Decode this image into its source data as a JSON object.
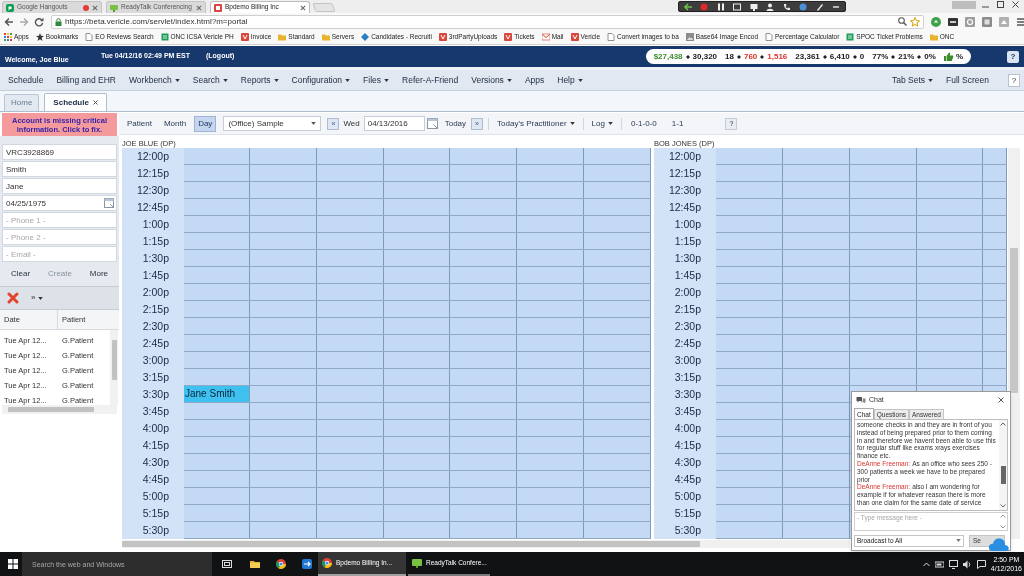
{
  "browser": {
    "tabs": [
      {
        "title": "Google Hangouts",
        "selected": false,
        "recording": true
      },
      {
        "title": "ReadyTalk Conferencing",
        "selected": false,
        "recording": false
      },
      {
        "title": "Bpdemo Billing Inc",
        "selected": true,
        "recording": false
      }
    ],
    "url": "https://beta.vericle.com/servlet/index.html?m=portal",
    "bookmarks": [
      {
        "label": "Apps",
        "kind": "apps"
      },
      {
        "label": "Bookmarks",
        "kind": "star"
      },
      {
        "label": "EO Reviews Search",
        "kind": "page"
      },
      {
        "label": "ONC ICSA Vericle PH",
        "kind": "sheet"
      },
      {
        "label": "Invoice",
        "kind": "logo"
      },
      {
        "label": "Standard",
        "kind": "folder"
      },
      {
        "label": "Servers",
        "kind": "folder"
      },
      {
        "label": "Candidates - Recruiti",
        "kind": "diamond"
      },
      {
        "label": "3rdPartyUploads",
        "kind": "logo"
      },
      {
        "label": "Tickets",
        "kind": "logo"
      },
      {
        "label": "Mail",
        "kind": "mail"
      },
      {
        "label": "Vericle",
        "kind": "logo"
      },
      {
        "label": "Convert images to ba",
        "kind": "page"
      },
      {
        "label": "Base64 Image Encod",
        "kind": "image"
      },
      {
        "label": "Percentage Calculator",
        "kind": "page"
      },
      {
        "label": "SPOC Ticket Problems",
        "kind": "sheet"
      },
      {
        "label": "ONC",
        "kind": "folder"
      }
    ]
  },
  "header": {
    "welcome": "Welcome, Joe Blue",
    "datetime": "Tue 04/12/16 02:49 PM EST",
    "logout": "(Logout)",
    "stats": [
      [
        {
          "text": "$27,438",
          "color": "#3c8c2c"
        },
        {
          "text": "30,320"
        }
      ],
      [
        {
          "text": "18"
        },
        {
          "text": "760",
          "color": "#d8342c"
        },
        {
          "text": "1,516",
          "color": "#d8342c"
        }
      ],
      [
        {
          "text": "23,361"
        },
        {
          "text": "6,410"
        },
        {
          "text": "0"
        }
      ],
      [
        {
          "text": "77%"
        },
        {
          "text": "21%"
        },
        {
          "text": "0%"
        }
      ]
    ],
    "rating": "%",
    "help": "?"
  },
  "menu": {
    "items": [
      {
        "label": "Schedule",
        "dropdown": false
      },
      {
        "label": "Billing and EHR",
        "dropdown": false
      },
      {
        "label": "Workbench",
        "dropdown": true
      },
      {
        "label": "Search",
        "dropdown": true
      },
      {
        "label": "Reports",
        "dropdown": true
      },
      {
        "label": "Configuration",
        "dropdown": true
      },
      {
        "label": "Files",
        "dropdown": true
      },
      {
        "label": "Refer-A-Friend",
        "dropdown": false
      },
      {
        "label": "Versions",
        "dropdown": true
      },
      {
        "label": "Apps",
        "dropdown": false
      },
      {
        "label": "Help",
        "dropdown": true
      }
    ],
    "right": [
      {
        "label": "Tab Sets",
        "dropdown": true
      },
      {
        "label": "Full Screen",
        "dropdown": false
      }
    ],
    "help": "?"
  },
  "tabs": [
    {
      "label": "Home",
      "selected": false,
      "closable": false
    },
    {
      "label": "Schedule",
      "selected": true,
      "closable": true
    }
  ],
  "patient_panel": {
    "alert": "Account is missing critical information. Click to fix.",
    "fields": [
      {
        "kind": "text",
        "value": "VRC3928869"
      },
      {
        "kind": "text",
        "value": "Smith"
      },
      {
        "kind": "text",
        "value": "Jane"
      },
      {
        "kind": "date",
        "value": "04/25/1975"
      },
      {
        "kind": "text",
        "placeholder": "- Phone 1 -"
      },
      {
        "kind": "text",
        "placeholder": "- Phone 2 -"
      },
      {
        "kind": "text",
        "placeholder": "- Email -"
      }
    ],
    "buttons": [
      {
        "label": "Clear",
        "disabled": false
      },
      {
        "label": "Create",
        "disabled": true
      },
      {
        "label": "More",
        "disabled": false
      }
    ],
    "more_menu": "»",
    "list": {
      "columns": [
        "Date",
        "Patient"
      ],
      "rows": [
        [
          "Tue Apr 12...",
          "G.Patient"
        ],
        [
          "Tue Apr 12...",
          "G.Patient"
        ],
        [
          "Tue Apr 12...",
          "G.Patient"
        ],
        [
          "Tue Apr 12...",
          "G.Patient"
        ],
        [
          "Tue Apr 12...",
          "G.Patient"
        ]
      ]
    }
  },
  "schedule": {
    "views": [
      {
        "label": "Patient",
        "selected": false
      },
      {
        "label": "Month",
        "selected": false
      },
      {
        "label": "Day",
        "selected": true
      }
    ],
    "office": "(Office) Sample",
    "prev": "«",
    "day": "Wed",
    "date": "04/13/2016",
    "today": "Today",
    "next": "»",
    "practitioner": "Today's Practitioner",
    "log": "Log",
    "counts": "0-1-0-0",
    "ratio": "1-1",
    "help": "?",
    "providers": [
      {
        "name": "JOE BLUE (DP)",
        "rows": [
          {
            "time": "12:00p"
          },
          {
            "time": "12:15p"
          },
          {
            "time": "12:30p"
          },
          {
            "time": "12:45p"
          },
          {
            "time": "1:00p"
          },
          {
            "time": "1:15p"
          },
          {
            "time": "1:30p"
          },
          {
            "time": "1:45p"
          },
          {
            "time": "2:00p"
          },
          {
            "time": "2:15p"
          },
          {
            "time": "2:30p"
          },
          {
            "time": "2:45p"
          },
          {
            "time": "3:00p"
          },
          {
            "time": "3:15p"
          },
          {
            "time": "3:30p",
            "appointment": "Jane Smith"
          },
          {
            "time": "3:45p"
          },
          {
            "time": "4:00p"
          },
          {
            "time": "4:15p"
          },
          {
            "time": "4:30p"
          },
          {
            "time": "4:45p"
          },
          {
            "time": "5:00p"
          },
          {
            "time": "5:15p"
          },
          {
            "time": "5:30p"
          }
        ]
      },
      {
        "name": "BOB JONES (DP)",
        "rows": [
          {
            "time": "12:00p"
          },
          {
            "time": "12:15p"
          },
          {
            "time": "12:30p"
          },
          {
            "time": "12:45p"
          },
          {
            "time": "1:00p"
          },
          {
            "time": "1:15p"
          },
          {
            "time": "1:30p"
          },
          {
            "time": "1:45p"
          },
          {
            "time": "2:00p"
          },
          {
            "time": "2:15p"
          },
          {
            "time": "2:30p"
          },
          {
            "time": "2:45p"
          },
          {
            "time": "3:00p"
          },
          {
            "time": "3:15p"
          },
          {
            "time": "3:30p"
          },
          {
            "time": "3:45p"
          },
          {
            "time": "4:00p"
          },
          {
            "time": "4:15p"
          },
          {
            "time": "4:30p"
          },
          {
            "time": "4:45p"
          },
          {
            "time": "5:00p"
          },
          {
            "time": "5:15p"
          },
          {
            "time": "5:30p"
          }
        ]
      }
    ]
  },
  "chat": {
    "title": "Chat",
    "tabs": [
      {
        "label": "Chat",
        "selected": true
      },
      {
        "label": "Questions",
        "selected": false
      },
      {
        "label": "Answered",
        "selected": false
      }
    ],
    "messages": [
      {
        "text": "someone checks in and they are in front of you instead of being prepared prior to them coming in and therefore we havent been able to use this for regular stuff like exams xrays exercises finance etc."
      },
      {
        "sender": "DeAnne Freeman:",
        "text": "As an office who sees 250 - 300 patients a week we have to be prepared prior"
      },
      {
        "sender": "DeAnne Freeman:",
        "text": "also I am wondering for example if for whatever reason there is more than one claim for the same date of service"
      }
    ],
    "placeholder": "- Type message here -",
    "broadcast": "Broadcast to All",
    "send": "Se"
  },
  "taskbar": {
    "placeholder": "Search the web and Windows",
    "windows": [
      {
        "title": "Bpdemo Billing In...",
        "selected": true
      },
      {
        "title": "ReadyTalk Confere...",
        "selected": false
      }
    ],
    "time": "2:50 PM",
    "date": "4/12/2016"
  }
}
